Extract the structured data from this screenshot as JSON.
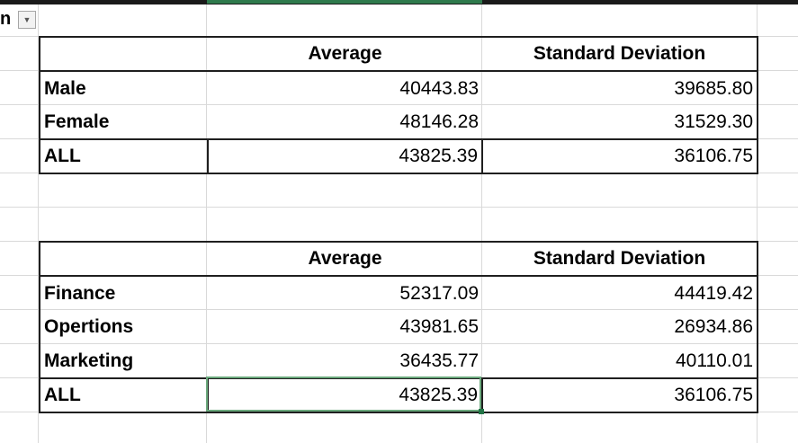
{
  "name_box": {
    "text": "n",
    "dropdown_icon": "chevron-down-icon"
  },
  "table1": {
    "headers": [
      "",
      "Average",
      "Standard Deviation"
    ],
    "rows": [
      [
        "Male",
        "40443.83",
        "39685.80"
      ],
      [
        "Female",
        "48146.28",
        "31529.30"
      ]
    ],
    "total": [
      "ALL",
      "43825.39",
      "36106.75"
    ]
  },
  "table2": {
    "headers": [
      "",
      "Average",
      "Standard Deviation"
    ],
    "rows": [
      [
        "Finance",
        "52317.09",
        "44419.42"
      ],
      [
        "Opertions",
        "43981.65",
        "26934.86"
      ],
      [
        "Marketing",
        "36435.77",
        "40110.01"
      ]
    ],
    "total": [
      "ALL",
      "43825.39",
      "36106.75"
    ]
  },
  "colors": {
    "grid": "#d9d9d9",
    "border": "#1f1f1f",
    "selection": "#2f7a4d"
  }
}
